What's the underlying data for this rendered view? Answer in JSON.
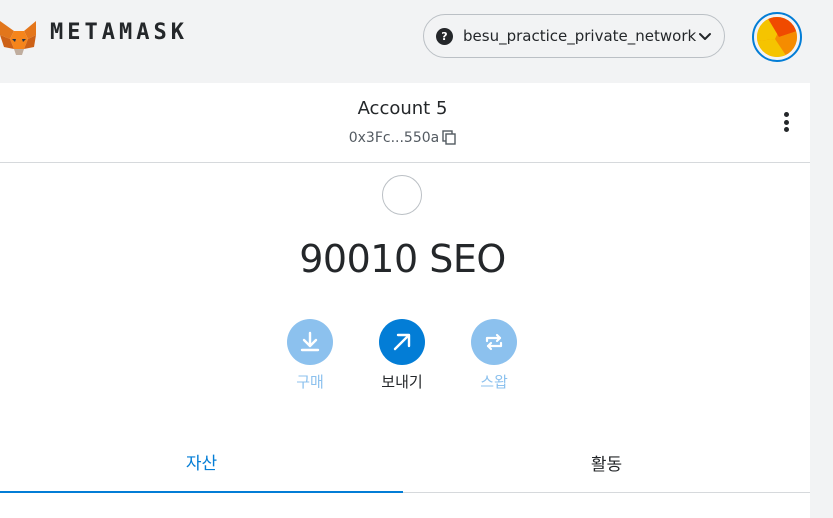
{
  "header": {
    "brand": "METAMASK",
    "network": {
      "name": "besu_practice_private_network",
      "status_icon": "question-icon",
      "status_glyph": "?"
    }
  },
  "account": {
    "name": "Account 5",
    "address_short": "0x3Fc...550a"
  },
  "balance": {
    "text": "90010 SEO"
  },
  "actions": {
    "buy_label": "구매",
    "send_label": "보내기",
    "swap_label": "스왑"
  },
  "tabs": {
    "assets_label": "자산",
    "activity_label": "활동",
    "active": "assets"
  },
  "colors": {
    "accent": "#037dd6",
    "disabled": "#8cc1ee",
    "text": "#24272a"
  }
}
